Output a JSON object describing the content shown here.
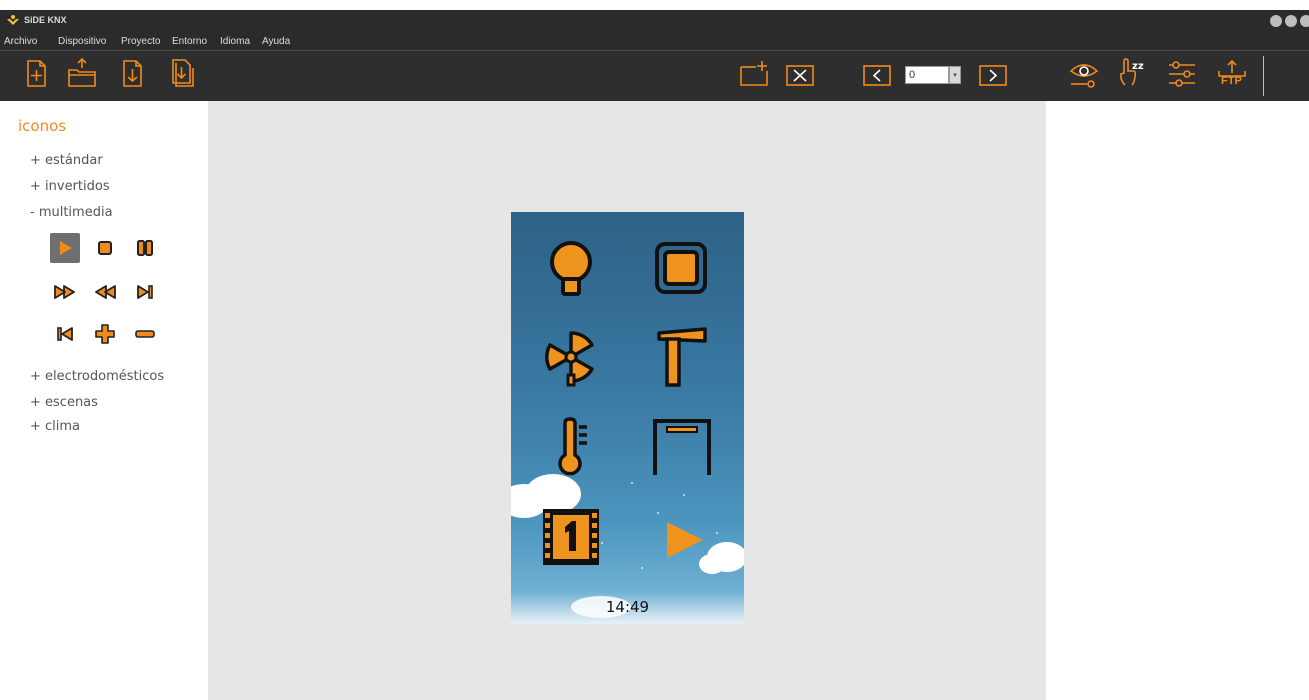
{
  "window": {
    "title": "SiDE KNX"
  },
  "menu": [
    "Archivo",
    "Dispositivo",
    "Proyecto",
    "Entorno",
    "Idioma",
    "Ayuda"
  ],
  "toolbar": {
    "page_value": "0",
    "ftp_label": "FTP",
    "accent_color": "#f08a1c"
  },
  "sidebar": {
    "title": "iconos",
    "categories": [
      {
        "label": "+ estándar"
      },
      {
        "label": "+ invertidos"
      },
      {
        "label": "- multimedia"
      },
      {
        "label": "+ electrodomésticos"
      },
      {
        "label": "+ escenas"
      },
      {
        "label": "+ clima"
      }
    ],
    "multimedia_icons": [
      "play-icon",
      "stop-icon",
      "pause-icon",
      "fast-forward-icon",
      "rewind-icon",
      "skip-forward-icon",
      "skip-back-icon",
      "plus-icon",
      "minus-icon"
    ]
  },
  "preview": {
    "time": "14:49",
    "tile_icons": [
      "lightbulb-icon",
      "button-icon",
      "fan-icon",
      "windsock-icon",
      "thermometer-icon",
      "door-frame-icon",
      "film-scene-icon",
      "play-icon"
    ]
  }
}
